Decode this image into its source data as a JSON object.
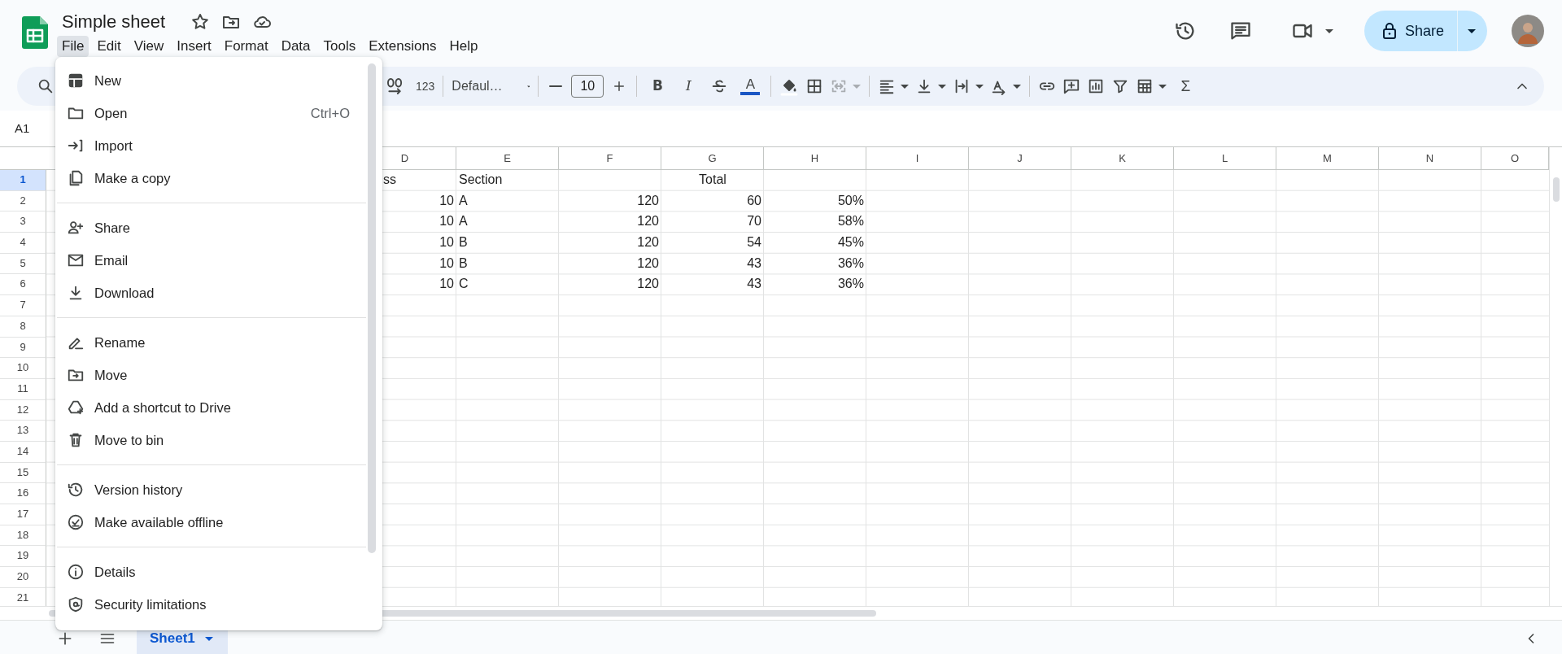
{
  "document": {
    "title": "Simple sheet"
  },
  "menubar": [
    {
      "label": "File",
      "selected": true
    },
    {
      "label": "Edit",
      "selected": false
    },
    {
      "label": "View",
      "selected": false
    },
    {
      "label": "Insert",
      "selected": false
    },
    {
      "label": "Format",
      "selected": false
    },
    {
      "label": "Data",
      "selected": false
    },
    {
      "label": "Tools",
      "selected": false
    },
    {
      "label": "Extensions",
      "selected": false
    },
    {
      "label": "Help",
      "selected": false
    }
  ],
  "share_button": {
    "label": "Share"
  },
  "toolbar": {
    "number_format": "123",
    "font": "Defaul…",
    "font_size": "10",
    "format_buttons": [
      "B",
      "I"
    ],
    "text_color_button": "A",
    "merge_cells": {
      "disabled": true
    },
    "functions_button": "Σ"
  },
  "name_box": "A1",
  "sheet": {
    "columns": [
      "D",
      "E",
      "F",
      "G",
      "H",
      "I",
      "J",
      "K",
      "L",
      "M",
      "N",
      "O"
    ],
    "rows": [
      {
        "number": "1",
        "selected": true,
        "cells": [
          {
            "text": "ss",
            "kind": "partial"
          },
          {
            "text": "Section",
            "kind": "text"
          },
          {
            "text": "Total",
            "kind": "merged"
          }
        ]
      },
      {
        "number": "2",
        "selected": false,
        "cells": [
          {
            "text": "10",
            "kind": "number"
          },
          {
            "text": "A",
            "kind": "text"
          },
          {
            "text": "120",
            "kind": "number"
          },
          {
            "text": "60",
            "kind": "number"
          },
          {
            "text": "50%",
            "kind": "number"
          }
        ]
      },
      {
        "number": "3",
        "selected": false,
        "cells": [
          {
            "text": "10",
            "kind": "number"
          },
          {
            "text": "A",
            "kind": "text"
          },
          {
            "text": "120",
            "kind": "number"
          },
          {
            "text": "70",
            "kind": "number"
          },
          {
            "text": "58%",
            "kind": "number"
          }
        ]
      },
      {
        "number": "4",
        "selected": false,
        "cells": [
          {
            "text": "10",
            "kind": "number"
          },
          {
            "text": "B",
            "kind": "text"
          },
          {
            "text": "120",
            "kind": "number"
          },
          {
            "text": "54",
            "kind": "number"
          },
          {
            "text": "45%",
            "kind": "number"
          }
        ]
      },
      {
        "number": "5",
        "selected": false,
        "cells": [
          {
            "text": "10",
            "kind": "number"
          },
          {
            "text": "B",
            "kind": "text"
          },
          {
            "text": "120",
            "kind": "number"
          },
          {
            "text": "43",
            "kind": "number"
          },
          {
            "text": "36%",
            "kind": "number"
          }
        ]
      },
      {
        "number": "6",
        "selected": false,
        "cells": [
          {
            "text": "10",
            "kind": "number"
          },
          {
            "text": "C",
            "kind": "text"
          },
          {
            "text": "120",
            "kind": "number"
          },
          {
            "text": "43",
            "kind": "number"
          },
          {
            "text": "36%",
            "kind": "number"
          }
        ]
      },
      {
        "number": "7",
        "selected": false
      },
      {
        "number": "8",
        "selected": false
      },
      {
        "number": "9",
        "selected": false
      },
      {
        "number": "10",
        "selected": false
      },
      {
        "number": "11",
        "selected": false
      },
      {
        "number": "12",
        "selected": false
      },
      {
        "number": "13",
        "selected": false
      },
      {
        "number": "14",
        "selected": false
      },
      {
        "number": "15",
        "selected": false
      },
      {
        "number": "16",
        "selected": false
      },
      {
        "number": "17",
        "selected": false
      },
      {
        "number": "18",
        "selected": false
      },
      {
        "number": "19",
        "selected": false
      },
      {
        "number": "20",
        "selected": false
      },
      {
        "number": "21",
        "selected": false
      }
    ]
  },
  "file_menu": {
    "groups": [
      {
        "items": [
          {
            "label": "New"
          },
          {
            "label": "Open",
            "shortcut": "Ctrl+O"
          },
          {
            "label": "Import"
          },
          {
            "label": "Make a copy"
          }
        ]
      },
      {
        "items": [
          {
            "label": "Share"
          },
          {
            "label": "Email"
          },
          {
            "label": "Download"
          }
        ]
      },
      {
        "items": [
          {
            "label": "Rename"
          },
          {
            "label": "Move"
          },
          {
            "label": "Add a shortcut to Drive"
          },
          {
            "label": "Move to bin"
          }
        ]
      },
      {
        "items": [
          {
            "label": "Version history"
          },
          {
            "label": "Make available offline"
          }
        ]
      },
      {
        "items": [
          {
            "label": "Details"
          },
          {
            "label": "Security limitations"
          }
        ]
      }
    ]
  },
  "sheet_tabs": [
    {
      "label": "Sheet1",
      "selected": true
    }
  ]
}
